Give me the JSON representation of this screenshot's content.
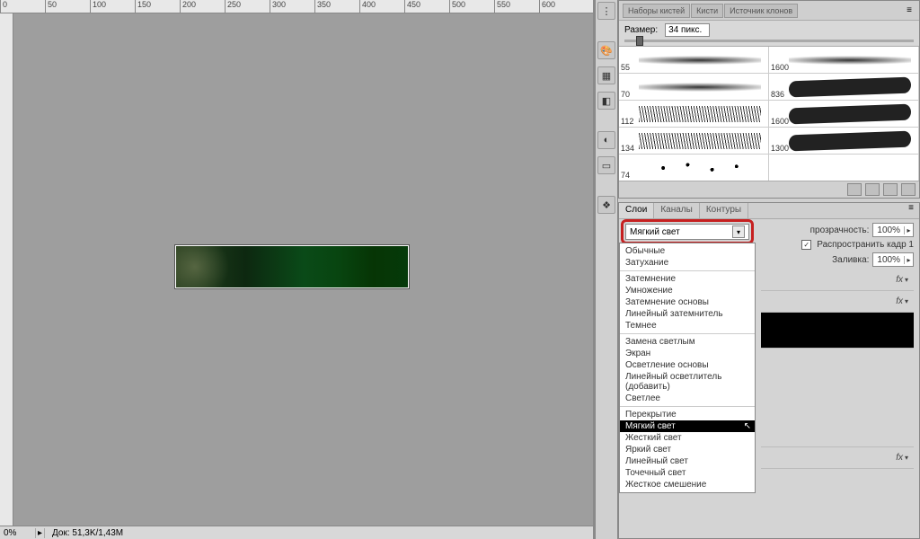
{
  "ruler_marks": [
    "0",
    "50",
    "100",
    "150",
    "200",
    "250",
    "300",
    "350",
    "400",
    "450",
    "500",
    "550",
    "600"
  ],
  "status": {
    "zoom": "0%",
    "doc": "Док: 51,3K/1,43M"
  },
  "brush_panel": {
    "tabs": [
      "Наборы кистей",
      "Кисти",
      "Источник клонов"
    ],
    "size_label": "Размер:",
    "size_value": "34 пикс.",
    "brushes": [
      {
        "size": "55",
        "style": "soft"
      },
      {
        "size": "1600",
        "style": "soft"
      },
      {
        "size": "70",
        "style": "soft"
      },
      {
        "size": "836",
        "style": "hard"
      },
      {
        "size": "112",
        "style": "grass"
      },
      {
        "size": "1600",
        "style": "hard"
      },
      {
        "size": "134",
        "style": "grass"
      },
      {
        "size": "1300",
        "style": "hard"
      },
      {
        "size": "74",
        "style": "scatter"
      },
      {
        "size": "",
        "style": ""
      }
    ]
  },
  "layers_panel": {
    "tabs": [
      "Слои",
      "Каналы",
      "Контуры"
    ],
    "blend_selected": "Мягкий свет",
    "opacity_label": "прозрачность:",
    "opacity_value": "100%",
    "propagate_label": "Распространить кадр 1",
    "fill_label": "Заливка:",
    "fill_value": "100%",
    "fx_label": "fx",
    "blend_groups": [
      [
        "Обычные",
        "Затухание"
      ],
      [
        "Затемнение",
        "Умножение",
        "Затемнение основы",
        "Линейный затемнитель",
        "Темнее"
      ],
      [
        "Замена светлым",
        "Экран",
        "Осветление основы",
        "Линейный осветлитель (добавить)",
        "Светлее"
      ],
      [
        "Перекрытие",
        "Мягкий свет",
        "Жесткий свет",
        "Яркий свет",
        "Линейный свет",
        "Точечный свет",
        "Жесткое смешение"
      ]
    ],
    "selected_option": "Мягкий свет"
  }
}
